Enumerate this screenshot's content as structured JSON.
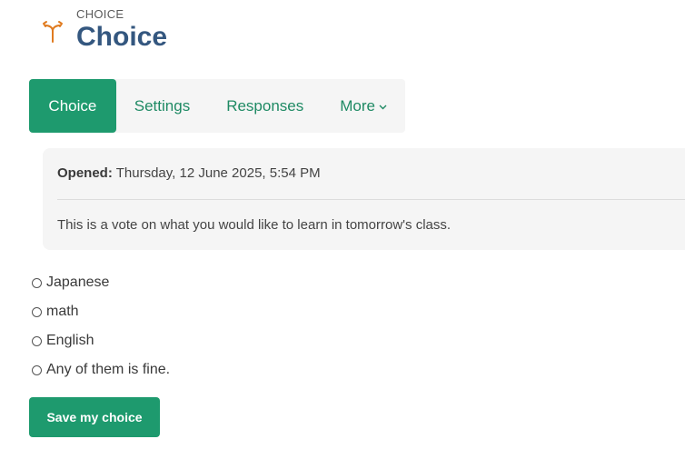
{
  "header": {
    "kicker": "CHOICE",
    "title": "Choice",
    "icon": "choice-activity-icon",
    "icon_color": "#e07b20"
  },
  "tabs": [
    {
      "label": "Choice",
      "active": true
    },
    {
      "label": "Settings",
      "active": false
    },
    {
      "label": "Responses",
      "active": false
    },
    {
      "label": "More",
      "active": false,
      "has_dropdown": true
    }
  ],
  "info": {
    "opened_label": "Opened:",
    "opened_value": "Thursday, 12 June 2025, 5:54 PM",
    "description": "This is a vote on what you would like to learn in tomorrow's class."
  },
  "options": [
    {
      "label": "Japanese",
      "selected": false
    },
    {
      "label": "math",
      "selected": false
    },
    {
      "label": "English",
      "selected": false
    },
    {
      "label": "Any of them is fine.",
      "selected": false
    }
  ],
  "save_button": {
    "label": "Save my choice"
  },
  "colors": {
    "accent": "#1e9a6e",
    "title": "#34577f",
    "tab_text": "#1f8a64"
  }
}
